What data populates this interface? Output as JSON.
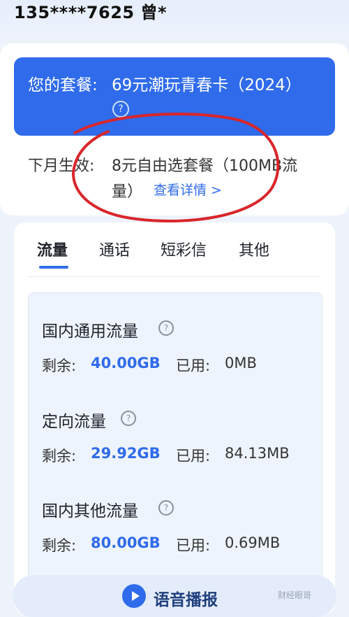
{
  "header": {
    "phone": "135****7625 曾*"
  },
  "plan": {
    "label": "您的套餐:",
    "value": "69元潮玩青春卡（2024）",
    "help_icon": "question-circle-icon"
  },
  "next_month": {
    "label": "下月生效:",
    "value_line1": "8元自由选套餐（100MB流",
    "value_line2": "量）",
    "detail_link": "查看详情 >"
  },
  "tabs": [
    {
      "label": "流量",
      "active": true
    },
    {
      "label": "通话",
      "active": false
    },
    {
      "label": "短彩信",
      "active": false
    },
    {
      "label": "其他",
      "active": false
    }
  ],
  "sections": [
    {
      "title": "国内通用流量",
      "remaining_label": "剩余:",
      "remaining": "40.00GB",
      "used_label": "已用:",
      "used": "0MB"
    },
    {
      "title": "定向流量",
      "remaining_label": "剩余:",
      "remaining": "29.92GB",
      "used_label": "已用:",
      "used": "84.13MB"
    },
    {
      "title": "国内其他流量",
      "remaining_label": "剩余:",
      "remaining": "80.00GB",
      "used_label": "已用:",
      "used": "0.69MB"
    }
  ],
  "voice": {
    "label": "语音播报",
    "icon": "play-icon"
  },
  "watermark": "财经眼哥",
  "colors": {
    "accent": "#2f6bea",
    "annotation": "#d9262b"
  }
}
